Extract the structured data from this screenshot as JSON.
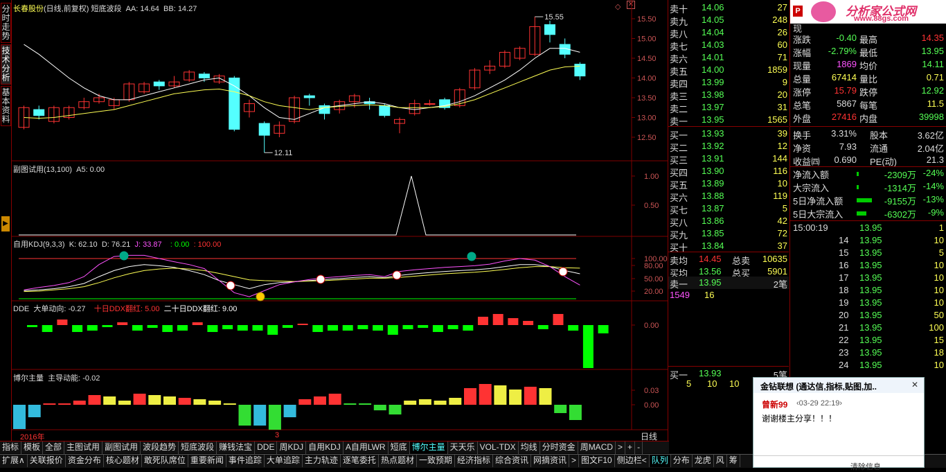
{
  "left_tabs": [
    "分时走势",
    "技术分析",
    "基本资料"
  ],
  "main": {
    "title": {
      "name": "长春股份",
      "cycle": "(日线,前复权)",
      "formula": "短底波段",
      "aa": "AA: 14.64",
      "bb": "BB: 14.27"
    },
    "price_axis": [
      "15.50",
      "15.00",
      "14.50",
      "14.00",
      "13.50",
      "13.00",
      "12.50"
    ],
    "hi_label": "15.55",
    "lo_label": "12.11",
    "sub1": {
      "title": "副图试用(13,100)",
      "a5": "A5: 0.00",
      "axis": [
        "1.00",
        "0.50"
      ]
    },
    "kdj": {
      "title": "自用KDJ(9,3,3)",
      "k": "K: 62.10",
      "d": "D: 76.21",
      "j": "J: 33.87",
      "z": ": 0.00",
      "h": ": 100.00",
      "axis": [
        "100.00",
        "80.00",
        "50.00",
        "20.00"
      ]
    },
    "dde": {
      "title": "DDE",
      "l1": "大单动向: -0.27",
      "l2": "十日DDX翻红: 5.00",
      "l3": "二十日DDX翻红: 9.00",
      "axis": [
        "0.00"
      ]
    },
    "boer": {
      "title": "博尔主量",
      "l1": "主导动能: -0.02",
      "axis": [
        "0.03",
        "0.00"
      ]
    },
    "date_left": "2016年",
    "date_mid": "3",
    "period": "日线"
  },
  "orderbook": {
    "asks": [
      [
        "卖十",
        "14.06",
        "27"
      ],
      [
        "卖九",
        "14.05",
        "248"
      ],
      [
        "卖八",
        "14.04",
        "26"
      ],
      [
        "卖七",
        "14.03",
        "60"
      ],
      [
        "卖六",
        "14.01",
        "71"
      ],
      [
        "卖五",
        "14.00",
        "1859"
      ],
      [
        "卖四",
        "13.99",
        "9"
      ],
      [
        "卖三",
        "13.98",
        "20"
      ],
      [
        "卖二",
        "13.97",
        "31"
      ],
      [
        "卖一",
        "13.95",
        "1565"
      ]
    ],
    "bids": [
      [
        "买一",
        "13.93",
        "39"
      ],
      [
        "买二",
        "13.92",
        "12"
      ],
      [
        "买三",
        "13.91",
        "144"
      ],
      [
        "买四",
        "13.90",
        "116"
      ],
      [
        "买五",
        "13.89",
        "10"
      ],
      [
        "买六",
        "13.88",
        "119"
      ],
      [
        "买七",
        "13.87",
        "5"
      ],
      [
        "买八",
        "13.86",
        "42"
      ],
      [
        "买九",
        "13.85",
        "72"
      ],
      [
        "买十",
        "13.84",
        "37"
      ]
    ],
    "avg_sell": [
      "卖均",
      "14.45",
      "总卖",
      "10635"
    ],
    "avg_buy": [
      "买均",
      "13.56",
      "总买",
      "5901"
    ],
    "sell1_queue": [
      "卖一",
      "13.95",
      "2笔"
    ],
    "queue_vals": [
      "1549",
      "16"
    ],
    "buy1_queue": [
      "买一",
      "13.93",
      "5笔"
    ],
    "buy_queue_vals": [
      "5",
      "10",
      "10"
    ]
  },
  "quote": {
    "brand": "分析家公式网",
    "url": "www.88gs.com",
    "rows": [
      [
        "涨跌",
        "-0.40",
        "最高",
        "14.35"
      ],
      [
        "涨幅",
        "-2.79%",
        "最低",
        "13.95"
      ],
      [
        "现量",
        "1869",
        "均价",
        "14.11"
      ],
      [
        "总量",
        "67414",
        "量比",
        "0.71"
      ],
      [
        "涨停",
        "15.79",
        "跌停",
        "12.92"
      ],
      [
        "总笔",
        "5867",
        "每笔",
        "11.5"
      ],
      [
        "外盘",
        "27416",
        "内盘",
        "39998"
      ]
    ],
    "rows2": [
      [
        "换手",
        "3.31%",
        "股本",
        "3.62亿"
      ],
      [
        "净资",
        "7.93",
        "流通",
        "2.04亿"
      ],
      [
        "收益㈣",
        "0.690",
        "PE(动)",
        "21.3"
      ]
    ],
    "flows": [
      [
        "净流入额",
        "-2309万",
        "-24%"
      ],
      [
        "大宗流入",
        "-1314万",
        "-14%"
      ],
      [
        "5日净流入额",
        "-9155万",
        "-13%"
      ],
      [
        "5日大宗流入",
        "-6302万",
        "-9%"
      ]
    ],
    "ticks": [
      [
        "15:00:19",
        "13.95",
        "1"
      ],
      [
        "14",
        "13.95",
        "10"
      ],
      [
        "15",
        "13.95",
        "5"
      ],
      [
        "16",
        "13.95",
        "10"
      ],
      [
        "17",
        "13.95",
        "10"
      ],
      [
        "18",
        "13.95",
        "10"
      ],
      [
        "19",
        "13.95",
        "10"
      ],
      [
        "20",
        "13.95",
        "50"
      ],
      [
        "21",
        "13.95",
        "100"
      ],
      [
        "22",
        "13.95",
        "15"
      ],
      [
        "23",
        "13.95",
        "18"
      ],
      [
        "24",
        "13.95",
        "10"
      ]
    ],
    "now_label": "现"
  },
  "tabs1": [
    "指标",
    "模板",
    "全部",
    "主图试用",
    "副图试用",
    "波段趋势",
    "短底波段",
    "赚钱法宝",
    "DDE",
    "周KDJ",
    "自用KDJ",
    "A自用LWR",
    "短底",
    "博尔主量",
    "天天乐",
    "VOL-TDX",
    "均线",
    "分时资金",
    "周MACD",
    ">",
    "+",
    "-"
  ],
  "tabs2": [
    "扩展∧",
    "关联报价",
    "资金分布",
    "核心题材",
    "敢死队席位",
    "重要新闻",
    "事件追踪",
    "大单追踪",
    "主力轨迹",
    "逐笔委托",
    "热点题材",
    "一致预期",
    "经济指标",
    "综合资讯",
    "网摘资讯",
    ">",
    "图文F10",
    "侧边栏<",
    "队列",
    "分布",
    "龙虎",
    "风",
    "筹"
  ],
  "popup": {
    "title": "金钻联想 (通达信,指标,贴图,加..",
    "user": "曾新99",
    "time": "‹03-29 22:19›",
    "msg": "谢谢楼主分享！！！",
    "bottom": "清除信息",
    "close": "✕"
  },
  "colors": {
    "up": "#ff3333",
    "down": "#54ffff",
    "yellow": "#ffff54",
    "green": "#00ff00",
    "magenta": "#ff54ff",
    "border": "#800000"
  }
}
